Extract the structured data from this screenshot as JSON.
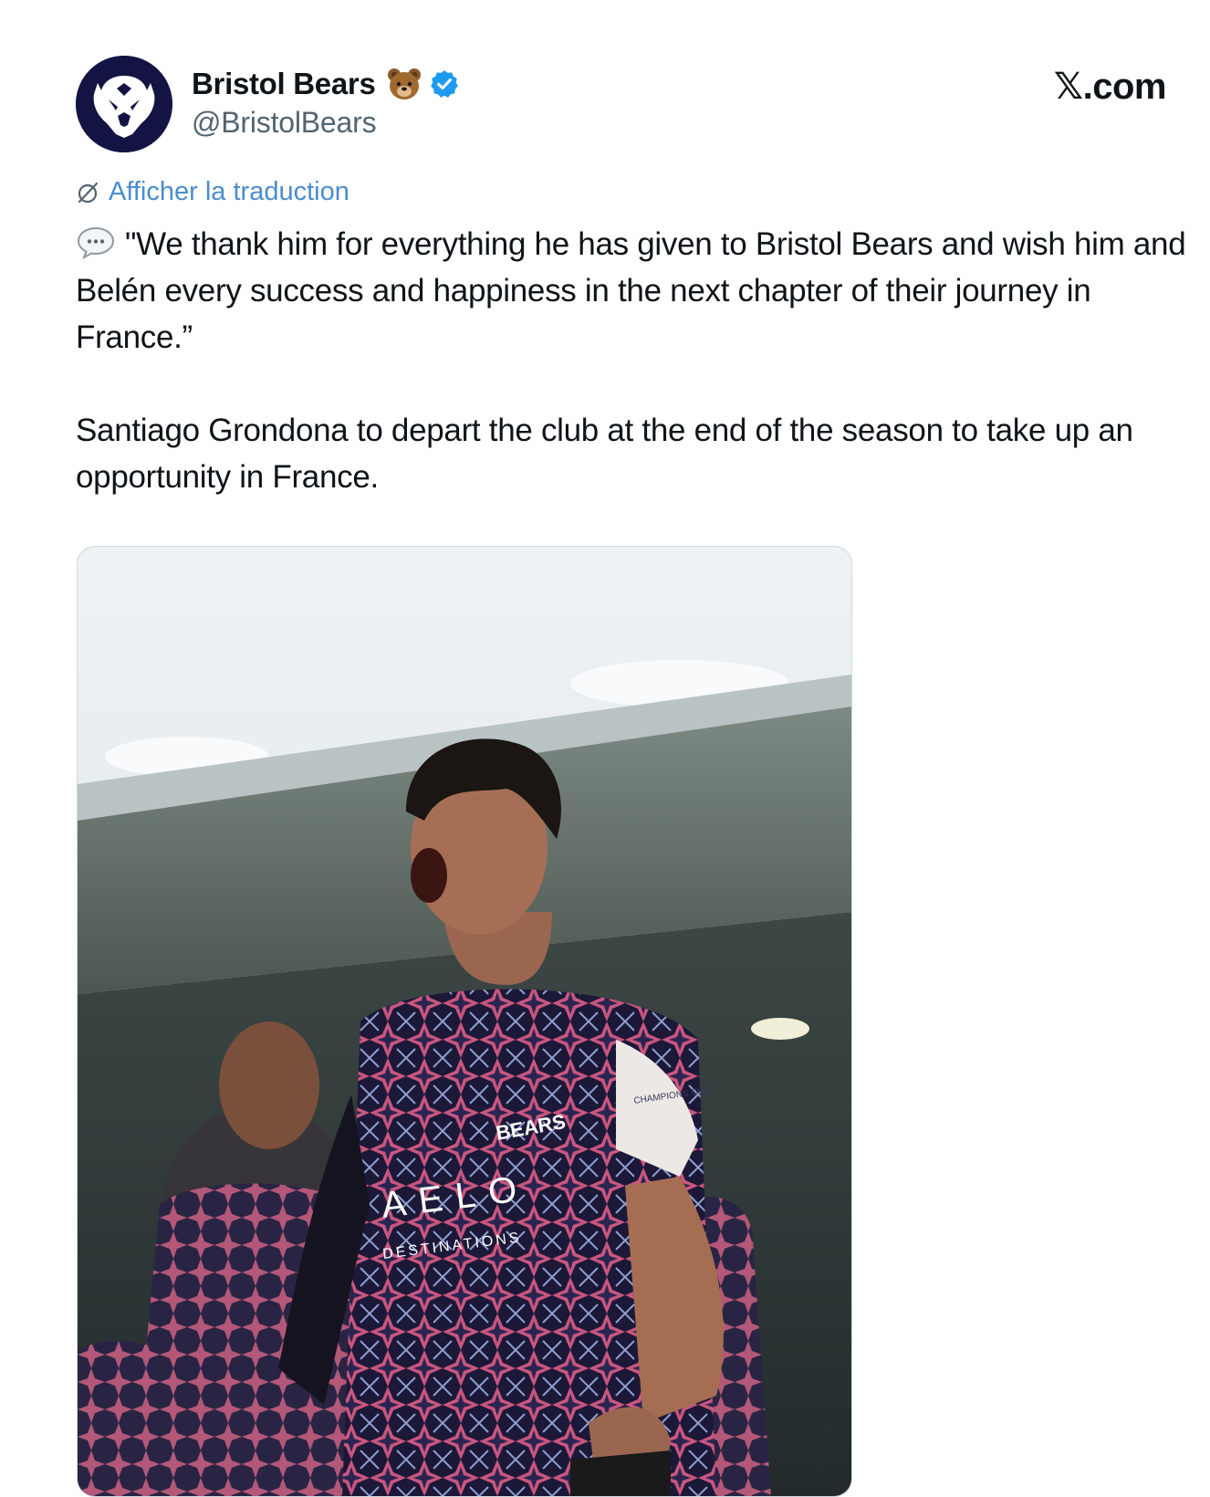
{
  "author": {
    "display_name": "Bristol Bears",
    "name_emoji": "🐻",
    "handle": "@BristolBears",
    "verified": true,
    "avatar_icon": "bristol-bears-logo"
  },
  "brand": {
    "x_glyph": "𝕏",
    "domain": ".com"
  },
  "translate_label": "Afficher la traduction",
  "tweet": {
    "paragraph_1": "\"We thank him for everything he has given to Bristol Bears and wish him and Belén every success and happiness in the next chapter of their journey in France.”",
    "paragraph_2": "Santiago Grondona to depart the club at the end of the season to take up an opportunity in France."
  },
  "media": {
    "jersey_logo": "BEARS",
    "sponsor_main": "AELO",
    "sponsor_sub": "DESTINATIONS",
    "sleeve_badge": "CHAMPIONS CUP"
  },
  "colors": {
    "link": "#4a8ccf",
    "verified": "#1d9bf0",
    "text": "#0f1419",
    "secondary_text": "#536471"
  }
}
